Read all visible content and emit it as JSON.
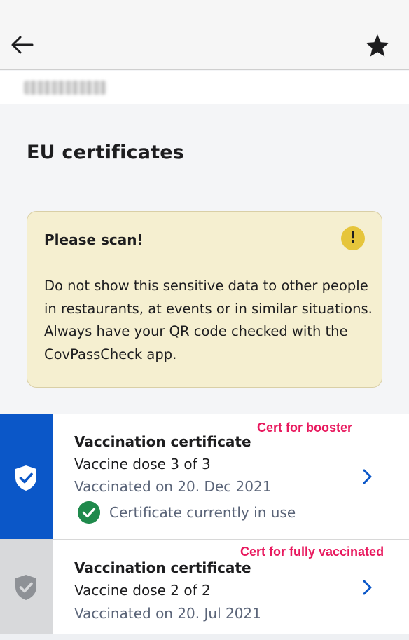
{
  "colors": {
    "accent": "#0b57c8",
    "warning_bg": "#f5efd0",
    "warning_icon": "#e6c53b",
    "success": "#1f8a4c",
    "annotation": "#e8195e"
  },
  "header": {
    "back_icon": "arrow-left-icon",
    "favorite_icon": "star-icon"
  },
  "page_title": "EU certificates",
  "warning": {
    "title": "Please scan!",
    "icon": "exclamation-icon",
    "icon_glyph": "!",
    "text": "Do not show this sensitive data to other people in restaurants, at events or in similar situations. Always have your QR code checked with the CovPassCheck app."
  },
  "certificates": [
    {
      "title": "Vaccination certificate",
      "dose": "Vaccine dose 3 of 3",
      "date": "Vaccinated on 20. Dec 2021",
      "status": "Certificate currently in use",
      "active": true,
      "annotation": "Cert for booster"
    },
    {
      "title": "Vaccination certificate",
      "dose": "Vaccine dose 2 of 2",
      "date": "Vaccinated on 20. Jul 2021",
      "active": false,
      "annotation": "Cert for fully vaccinated"
    }
  ]
}
